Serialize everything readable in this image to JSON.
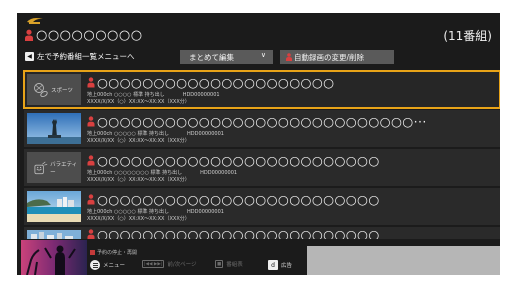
{
  "header": {
    "title": "○○○○○○○○○",
    "count": "(11番組)"
  },
  "toolbar": {
    "back_key": "◀",
    "back_label": "左で予約番組一覧メニューへ",
    "bulk_edit_label": "まとめて編集",
    "bulk_edit_chevron": "∨",
    "auto_rec_label": "自動録画の変更/削除"
  },
  "programs": [
    {
      "title": "○○○○○○○○○○○○○○○○○○○○○",
      "channel": "地上000ch ○○○○ 標準 持ち出し",
      "hdd": "HDD00000001",
      "datetime": "XXXX/X/XX（○）XX:XX〜XX:XX（XXX分）",
      "thumb": "genre-sports",
      "genre_label": "スポーツ",
      "selected": true
    },
    {
      "title": "○○○○○○○○○○○○○○○○○○○○○○○○○○○○···",
      "channel": "地上000ch ○○○○○ 標準 持ち出し",
      "hdd": "HDD00000001",
      "datetime": "XXXX/X/XX（○）XX:XX〜XX:XX（XXX分）",
      "thumb": "photo-statue",
      "selected": false
    },
    {
      "title": "○○○○○○○○○○○○○○○○○○○○○○○○○",
      "channel": "地上000ch ○○○○○○○○ 標準 持ち出し",
      "hdd": "HDD00000001",
      "datetime": "XXXX/X/XX（○）XX:XX〜XX:XX（XXX分）",
      "thumb": "genre-variety",
      "genre_label": "バラエティー",
      "selected": false
    },
    {
      "title": "○○○○○○○○○○○○○○○○○○○○○○○○○",
      "channel": "地上000ch ○○○○○ 標準 持ち出し",
      "hdd": "HDD00000001",
      "datetime": "XXXX/X/XX（○）XX:XX〜XX:XX（XXX分）",
      "thumb": "photo-beach",
      "selected": false
    },
    {
      "title": "○○○○○○○○○○○○○○○○○○○○○○○○○",
      "thumb": "photo-city",
      "selected": false
    }
  ],
  "footer": {
    "stop_note": "予約の停止・再開",
    "menu_label": "メニュー",
    "page_key": "|◀◀ ▶▶|",
    "page_label": "前/次ページ",
    "delete_key": "■",
    "delete_label": "番組表",
    "ad_key": "d",
    "ad_label": "広告"
  },
  "colors": {
    "accent": "#e8a318",
    "record_icon": "#d94040",
    "background": "#1b1b1b",
    "row": "#2a2a2a"
  }
}
